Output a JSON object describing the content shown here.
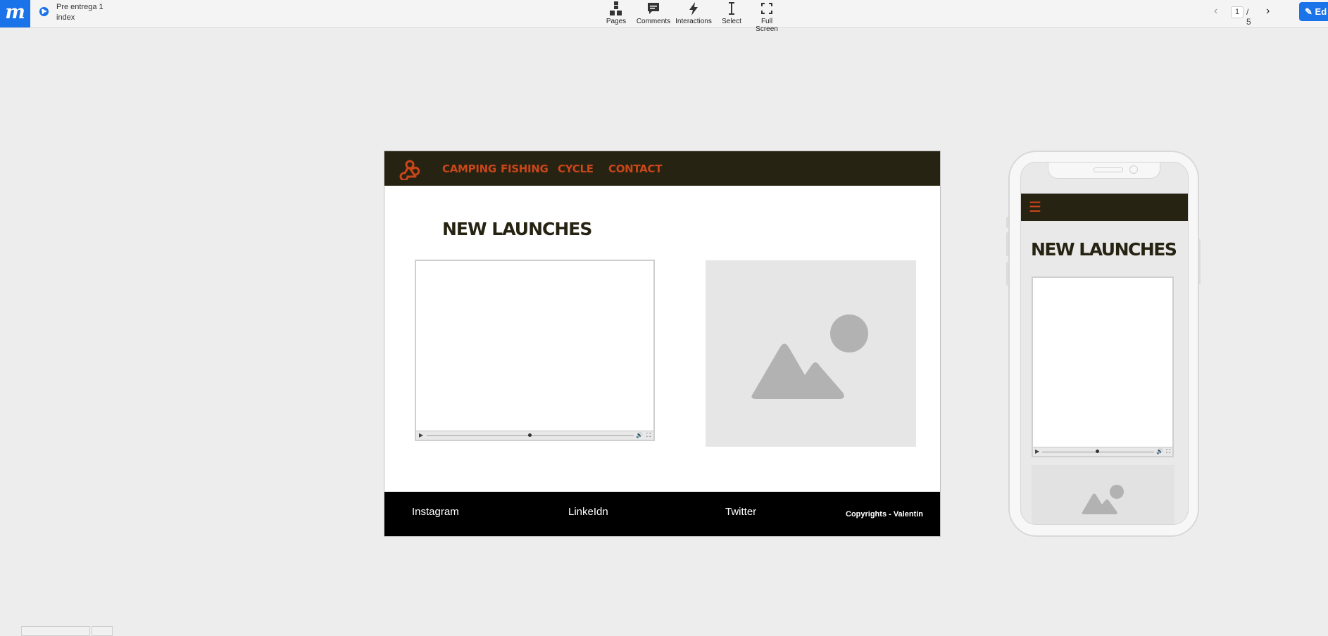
{
  "app": {
    "project_name": "Pre entrega 1",
    "page_name": "index"
  },
  "toolbar": {
    "pages_label": "Pages",
    "comments_label": "Comments",
    "interactions_label": "Interactions",
    "select_label": "Select",
    "fullscreen_label": "Full Screen"
  },
  "pager": {
    "current": "1",
    "total": "/ 5",
    "prev_icon": "chevron-left-icon",
    "next_icon": "chevron-right-icon"
  },
  "edit_button": {
    "label": "Ed"
  },
  "desktop": {
    "nav": {
      "logo_icon": "webhook-icon",
      "links": [
        "CAMPING",
        "FISHING",
        "CYCLE",
        "CONTACT"
      ]
    },
    "title": "NEW LAUNCHES",
    "footer": {
      "links": [
        "Instagram",
        "LinkeIdn",
        "Twitter"
      ],
      "copyright": "Copyrights -  Valentin"
    }
  },
  "mobile": {
    "menu_icon": "hamburger-icon",
    "title": "NEW LAUNCHES"
  },
  "colors": {
    "brand_blue": "#1a73e8",
    "nav_bg": "#262312",
    "accent_orange": "#c8461a",
    "footer_bg": "#000000",
    "canvas_bg": "#ededed"
  }
}
